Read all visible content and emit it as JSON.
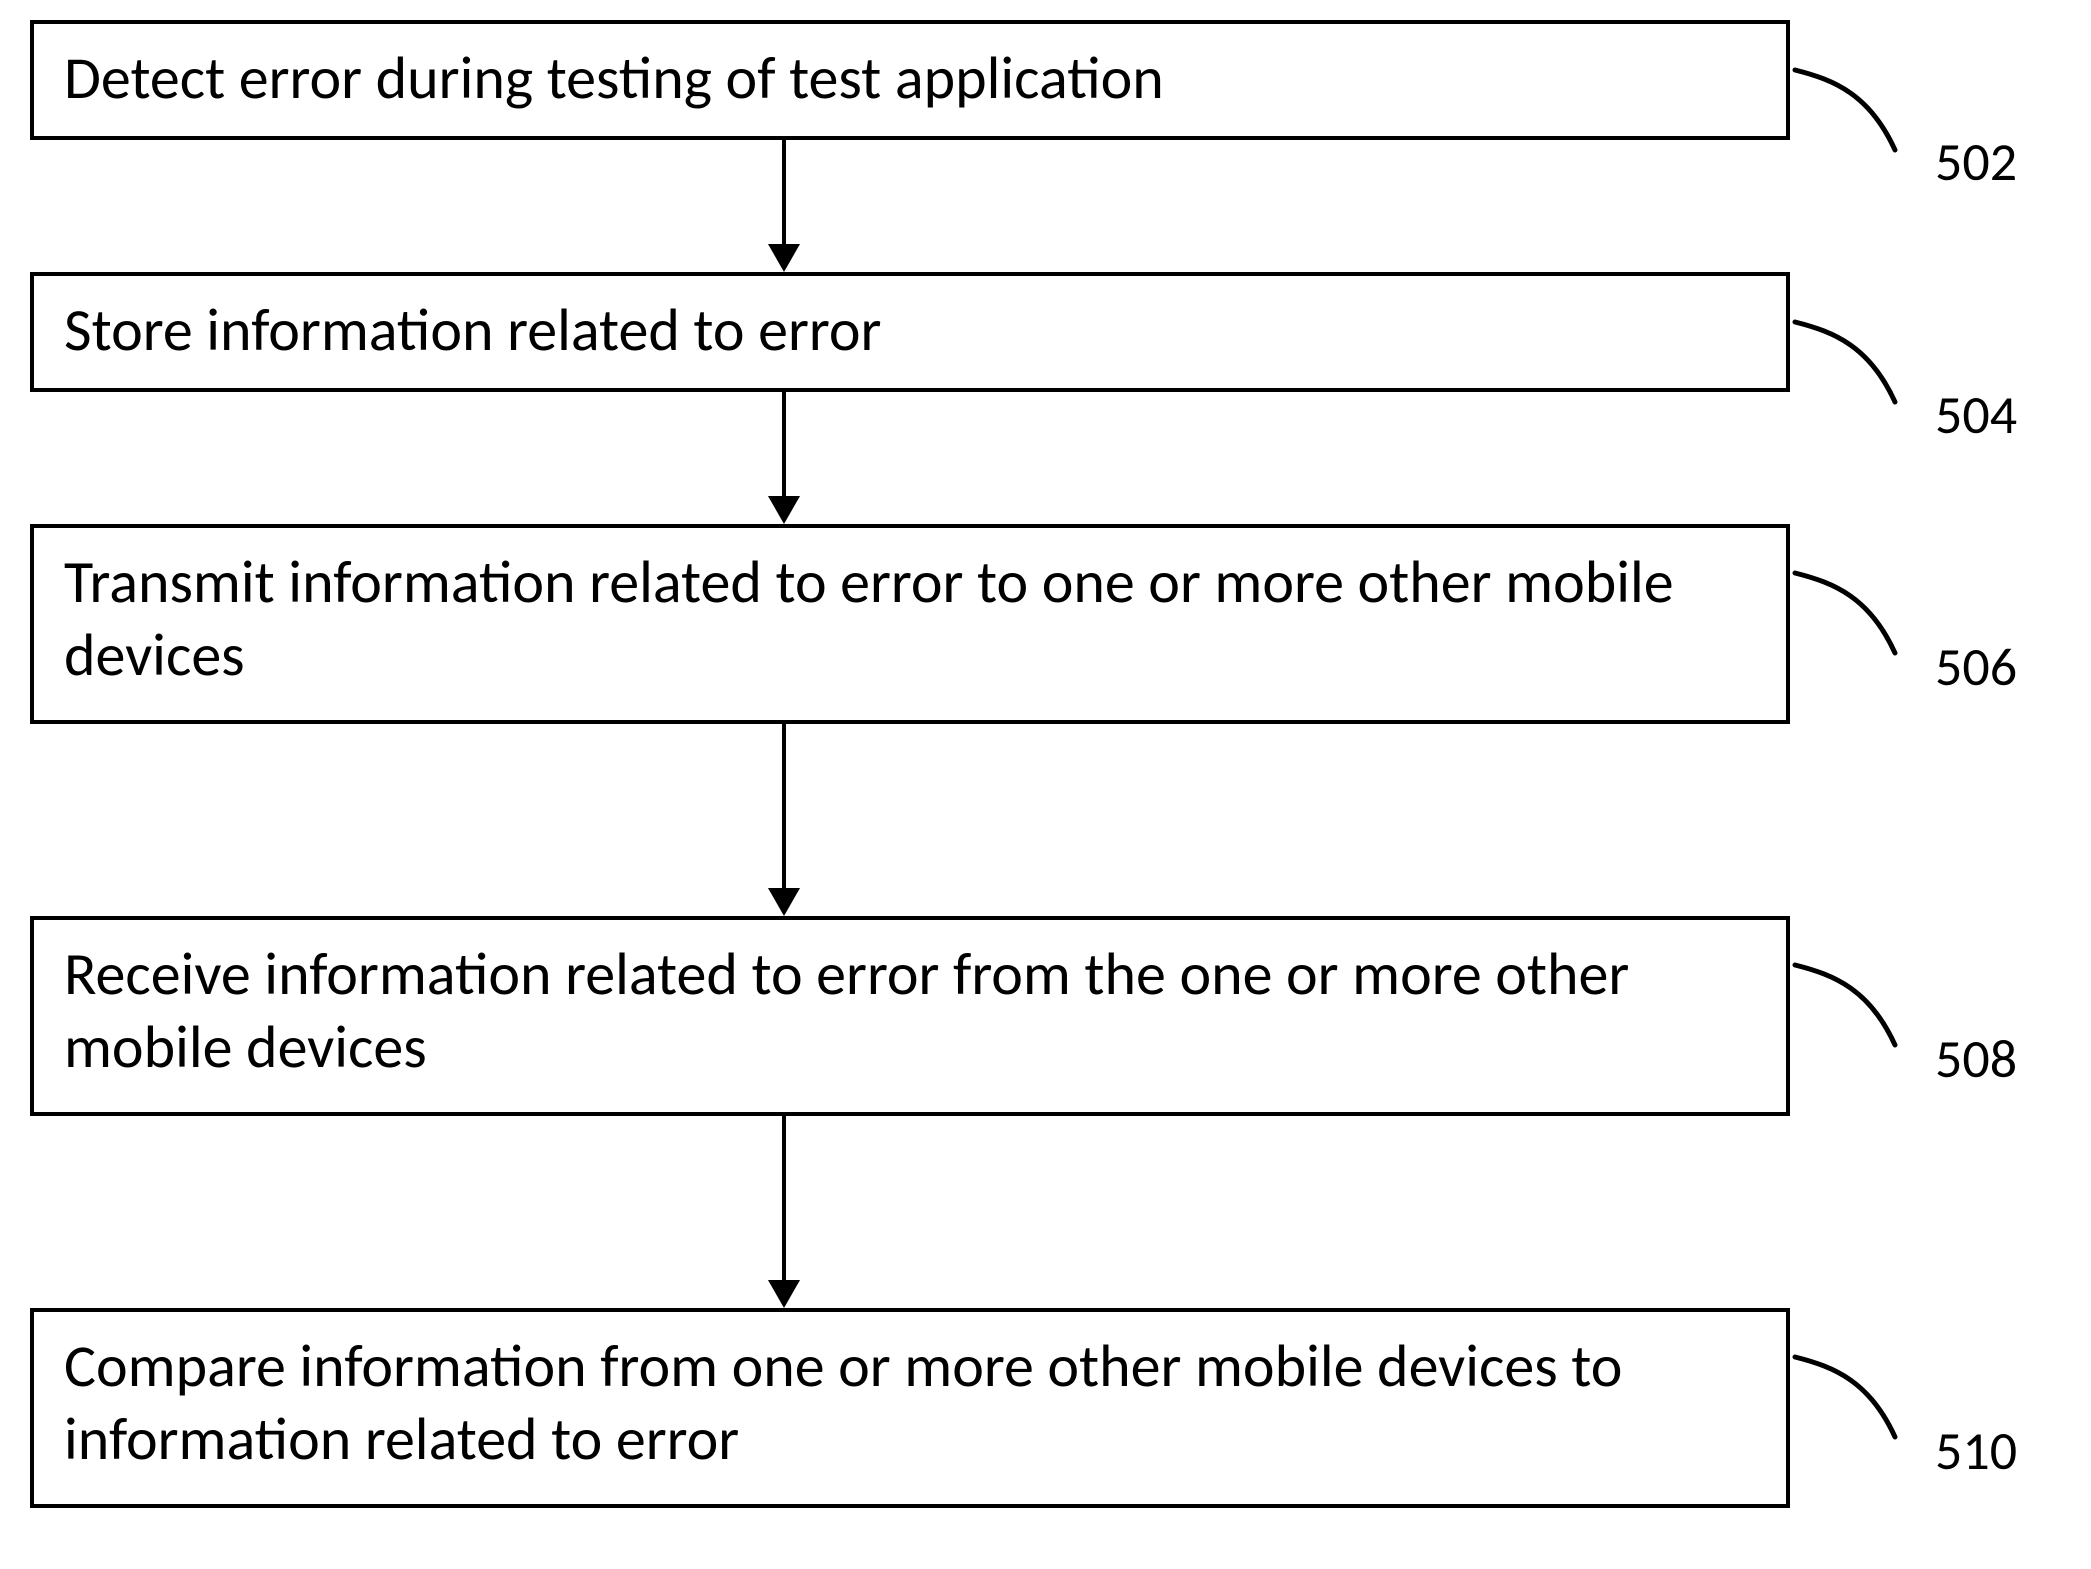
{
  "steps": [
    {
      "text": "Detect error during testing of test application",
      "label": "502"
    },
    {
      "text": "Store information related to error",
      "label": "504"
    },
    {
      "text": "Transmit information related to error to one or more other mobile devices",
      "label": "506"
    },
    {
      "text": "Receive information related to error from the one or more other mobile devices",
      "label": "508"
    },
    {
      "text": "Compare information from one or more other mobile devices to information related to error",
      "label": "510"
    }
  ]
}
